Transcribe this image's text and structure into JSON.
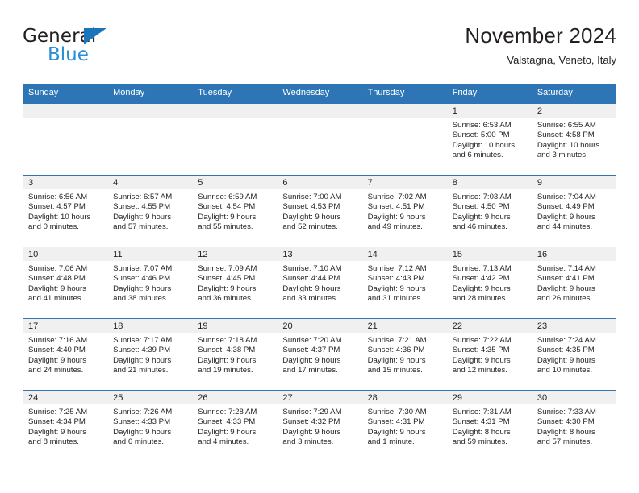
{
  "brand": {
    "name_top": "General",
    "name_bottom": "Blue",
    "triangle_color": "#1b75bb",
    "blue_text_color": "#2b8fd6"
  },
  "header": {
    "title": "November 2024",
    "subtitle": "Valstagna, Veneto, Italy"
  },
  "colors": {
    "header_blue": "#2e75b6",
    "daynum_band": "#f0f0f0",
    "text": "#231f20",
    "header_text": "#ffffff"
  },
  "calendar": {
    "weekday_headers": [
      "Sunday",
      "Monday",
      "Tuesday",
      "Wednesday",
      "Thursday",
      "Friday",
      "Saturday"
    ],
    "labels": {
      "sunrise_prefix": "Sunrise:",
      "sunset_prefix": "Sunset:",
      "daylight_prefix": "Daylight:"
    },
    "weeks": [
      [
        {
          "day": "",
          "empty": true
        },
        {
          "day": "",
          "empty": true
        },
        {
          "day": "",
          "empty": true
        },
        {
          "day": "",
          "empty": true
        },
        {
          "day": "",
          "empty": true
        },
        {
          "day": "1",
          "sunrise": "Sunrise: 6:53 AM",
          "sunset": "Sunset: 5:00 PM",
          "daylight_line1": "Daylight: 10 hours",
          "daylight_line2": "and 6 minutes."
        },
        {
          "day": "2",
          "sunrise": "Sunrise: 6:55 AM",
          "sunset": "Sunset: 4:58 PM",
          "daylight_line1": "Daylight: 10 hours",
          "daylight_line2": "and 3 minutes."
        }
      ],
      [
        {
          "day": "3",
          "sunrise": "Sunrise: 6:56 AM",
          "sunset": "Sunset: 4:57 PM",
          "daylight_line1": "Daylight: 10 hours",
          "daylight_line2": "and 0 minutes."
        },
        {
          "day": "4",
          "sunrise": "Sunrise: 6:57 AM",
          "sunset": "Sunset: 4:55 PM",
          "daylight_line1": "Daylight: 9 hours",
          "daylight_line2": "and 57 minutes."
        },
        {
          "day": "5",
          "sunrise": "Sunrise: 6:59 AM",
          "sunset": "Sunset: 4:54 PM",
          "daylight_line1": "Daylight: 9 hours",
          "daylight_line2": "and 55 minutes."
        },
        {
          "day": "6",
          "sunrise": "Sunrise: 7:00 AM",
          "sunset": "Sunset: 4:53 PM",
          "daylight_line1": "Daylight: 9 hours",
          "daylight_line2": "and 52 minutes."
        },
        {
          "day": "7",
          "sunrise": "Sunrise: 7:02 AM",
          "sunset": "Sunset: 4:51 PM",
          "daylight_line1": "Daylight: 9 hours",
          "daylight_line2": "and 49 minutes."
        },
        {
          "day": "8",
          "sunrise": "Sunrise: 7:03 AM",
          "sunset": "Sunset: 4:50 PM",
          "daylight_line1": "Daylight: 9 hours",
          "daylight_line2": "and 46 minutes."
        },
        {
          "day": "9",
          "sunrise": "Sunrise: 7:04 AM",
          "sunset": "Sunset: 4:49 PM",
          "daylight_line1": "Daylight: 9 hours",
          "daylight_line2": "and 44 minutes."
        }
      ],
      [
        {
          "day": "10",
          "sunrise": "Sunrise: 7:06 AM",
          "sunset": "Sunset: 4:48 PM",
          "daylight_line1": "Daylight: 9 hours",
          "daylight_line2": "and 41 minutes."
        },
        {
          "day": "11",
          "sunrise": "Sunrise: 7:07 AM",
          "sunset": "Sunset: 4:46 PM",
          "daylight_line1": "Daylight: 9 hours",
          "daylight_line2": "and 38 minutes."
        },
        {
          "day": "12",
          "sunrise": "Sunrise: 7:09 AM",
          "sunset": "Sunset: 4:45 PM",
          "daylight_line1": "Daylight: 9 hours",
          "daylight_line2": "and 36 minutes."
        },
        {
          "day": "13",
          "sunrise": "Sunrise: 7:10 AM",
          "sunset": "Sunset: 4:44 PM",
          "daylight_line1": "Daylight: 9 hours",
          "daylight_line2": "and 33 minutes."
        },
        {
          "day": "14",
          "sunrise": "Sunrise: 7:12 AM",
          "sunset": "Sunset: 4:43 PM",
          "daylight_line1": "Daylight: 9 hours",
          "daylight_line2": "and 31 minutes."
        },
        {
          "day": "15",
          "sunrise": "Sunrise: 7:13 AM",
          "sunset": "Sunset: 4:42 PM",
          "daylight_line1": "Daylight: 9 hours",
          "daylight_line2": "and 28 minutes."
        },
        {
          "day": "16",
          "sunrise": "Sunrise: 7:14 AM",
          "sunset": "Sunset: 4:41 PM",
          "daylight_line1": "Daylight: 9 hours",
          "daylight_line2": "and 26 minutes."
        }
      ],
      [
        {
          "day": "17",
          "sunrise": "Sunrise: 7:16 AM",
          "sunset": "Sunset: 4:40 PM",
          "daylight_line1": "Daylight: 9 hours",
          "daylight_line2": "and 24 minutes."
        },
        {
          "day": "18",
          "sunrise": "Sunrise: 7:17 AM",
          "sunset": "Sunset: 4:39 PM",
          "daylight_line1": "Daylight: 9 hours",
          "daylight_line2": "and 21 minutes."
        },
        {
          "day": "19",
          "sunrise": "Sunrise: 7:18 AM",
          "sunset": "Sunset: 4:38 PM",
          "daylight_line1": "Daylight: 9 hours",
          "daylight_line2": "and 19 minutes."
        },
        {
          "day": "20",
          "sunrise": "Sunrise: 7:20 AM",
          "sunset": "Sunset: 4:37 PM",
          "daylight_line1": "Daylight: 9 hours",
          "daylight_line2": "and 17 minutes."
        },
        {
          "day": "21",
          "sunrise": "Sunrise: 7:21 AM",
          "sunset": "Sunset: 4:36 PM",
          "daylight_line1": "Daylight: 9 hours",
          "daylight_line2": "and 15 minutes."
        },
        {
          "day": "22",
          "sunrise": "Sunrise: 7:22 AM",
          "sunset": "Sunset: 4:35 PM",
          "daylight_line1": "Daylight: 9 hours",
          "daylight_line2": "and 12 minutes."
        },
        {
          "day": "23",
          "sunrise": "Sunrise: 7:24 AM",
          "sunset": "Sunset: 4:35 PM",
          "daylight_line1": "Daylight: 9 hours",
          "daylight_line2": "and 10 minutes."
        }
      ],
      [
        {
          "day": "24",
          "sunrise": "Sunrise: 7:25 AM",
          "sunset": "Sunset: 4:34 PM",
          "daylight_line1": "Daylight: 9 hours",
          "daylight_line2": "and 8 minutes."
        },
        {
          "day": "25",
          "sunrise": "Sunrise: 7:26 AM",
          "sunset": "Sunset: 4:33 PM",
          "daylight_line1": "Daylight: 9 hours",
          "daylight_line2": "and 6 minutes."
        },
        {
          "day": "26",
          "sunrise": "Sunrise: 7:28 AM",
          "sunset": "Sunset: 4:33 PM",
          "daylight_line1": "Daylight: 9 hours",
          "daylight_line2": "and 4 minutes."
        },
        {
          "day": "27",
          "sunrise": "Sunrise: 7:29 AM",
          "sunset": "Sunset: 4:32 PM",
          "daylight_line1": "Daylight: 9 hours",
          "daylight_line2": "and 3 minutes."
        },
        {
          "day": "28",
          "sunrise": "Sunrise: 7:30 AM",
          "sunset": "Sunset: 4:31 PM",
          "daylight_line1": "Daylight: 9 hours",
          "daylight_line2": "and 1 minute."
        },
        {
          "day": "29",
          "sunrise": "Sunrise: 7:31 AM",
          "sunset": "Sunset: 4:31 PM",
          "daylight_line1": "Daylight: 8 hours",
          "daylight_line2": "and 59 minutes."
        },
        {
          "day": "30",
          "sunrise": "Sunrise: 7:33 AM",
          "sunset": "Sunset: 4:30 PM",
          "daylight_line1": "Daylight: 8 hours",
          "daylight_line2": "and 57 minutes."
        }
      ]
    ]
  }
}
